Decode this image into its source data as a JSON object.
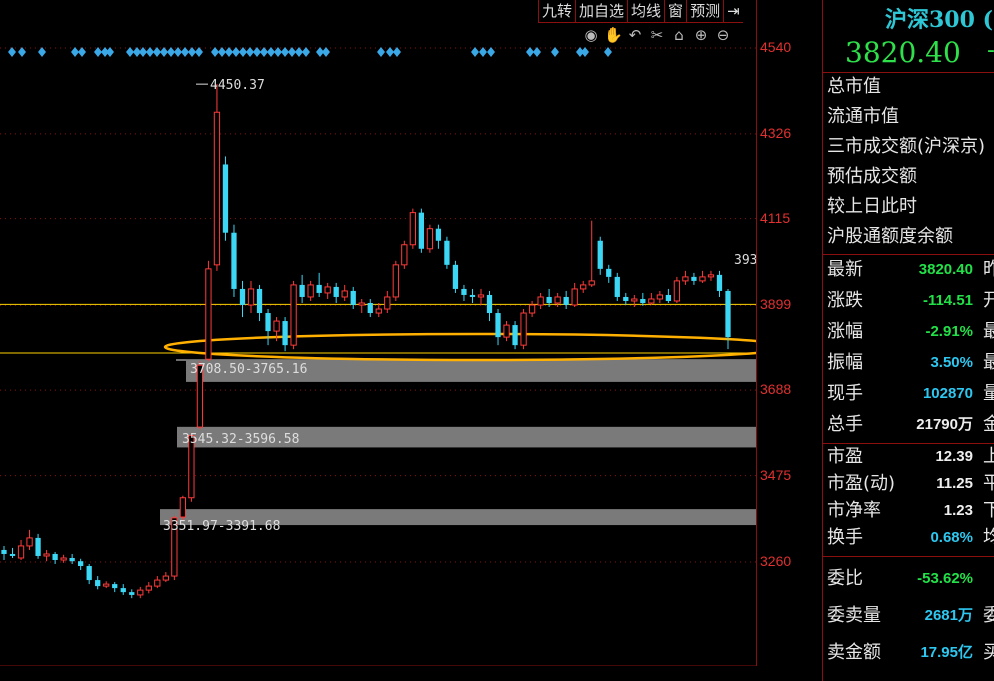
{
  "toolbar": {
    "buttons": [
      {
        "label": "九转",
        "name": "jiuzhuan-button"
      },
      {
        "label": "加自选",
        "name": "add-watchlist-button"
      },
      {
        "label": "均线",
        "name": "moving-average-button"
      },
      {
        "label": "窗",
        "name": "window-button"
      },
      {
        "label": "预测",
        "name": "forecast-button"
      },
      {
        "label": "⇥",
        "name": "expand-panel-button"
      }
    ]
  },
  "tools": [
    {
      "icon": "eye-icon",
      "glyph": "◉"
    },
    {
      "icon": "hand-icon",
      "glyph": "✋"
    },
    {
      "icon": "undo-icon",
      "glyph": "↶"
    },
    {
      "icon": "scissors-icon",
      "glyph": "✂"
    },
    {
      "icon": "lock-icon",
      "glyph": "⌂"
    },
    {
      "icon": "zoom-in-icon",
      "glyph": "⊕"
    },
    {
      "icon": "zoom-out-icon",
      "glyph": "⊖"
    }
  ],
  "axis": {
    "labels": [
      "4540",
      "4326",
      "4115",
      "3899",
      "3688",
      "3475",
      "3260"
    ]
  },
  "annotations": {
    "high_label": "4450.37",
    "gap1": "3708.50-3765.16",
    "gap2": "3545.32-3596.58",
    "gap3": "3351.97-3391.68",
    "cutoff_label": "393"
  },
  "panel": {
    "title": "沪深300 (",
    "price": "3820.40",
    "price_suffix": "-",
    "info_rows": [
      {
        "label": "总市值"
      },
      {
        "label": "流通市值"
      },
      {
        "label": "三市成交额(沪深京)"
      },
      {
        "label": "预估成交额"
      },
      {
        "label": "较上日此时"
      },
      {
        "label": "沪股通额度余额"
      }
    ],
    "quote_rows": [
      {
        "label": "最新",
        "value": "3820.40",
        "color": "green",
        "suffix": "昨"
      },
      {
        "label": "涨跌",
        "value": "-114.51",
        "color": "green",
        "suffix": "开"
      },
      {
        "label": "涨幅",
        "value": "-2.91%",
        "color": "green",
        "suffix": "最"
      },
      {
        "label": "振幅",
        "value": "3.50%",
        "color": "cyan",
        "suffix": "最"
      },
      {
        "label": "现手",
        "value": "102870",
        "color": "cyan",
        "suffix": "量"
      },
      {
        "label": "总手",
        "value": "21790万",
        "color": "white",
        "suffix": "金"
      }
    ],
    "valuation_rows": [
      {
        "label": "市盈",
        "value": "12.39",
        "color": "white",
        "suffix": "上"
      },
      {
        "label": "市盈(动)",
        "value": "11.25",
        "color": "white",
        "suffix": "平"
      },
      {
        "label": "市净率",
        "value": "1.23",
        "color": "white",
        "suffix": "下"
      },
      {
        "label": "换手",
        "value": "0.68%",
        "color": "cyan",
        "suffix": "均"
      }
    ],
    "order_rows": [
      {
        "label": "委比",
        "value": "-53.62%",
        "color": "green",
        "suffix": ""
      },
      {
        "label": "委卖量",
        "value": "2681万",
        "color": "cyan",
        "suffix": "委"
      },
      {
        "label": "卖金额",
        "value": "17.95亿",
        "color": "cyan",
        "suffix": "买"
      }
    ]
  },
  "colors": {
    "up": "#ff3b3b",
    "down": "#3cd7f5",
    "grid": "#8a0f0f",
    "yellow": "#ffd400",
    "gap": "#7a7a7a"
  },
  "chart_data": {
    "type": "candlestick",
    "title": "沪深300",
    "ylim": [
      3150,
      4660
    ],
    "y_ticks": [
      4540,
      4326,
      4115,
      3899,
      3688,
      3475,
      3260
    ],
    "reference_lines": [
      3899,
      3750
    ],
    "gaps": [
      {
        "low": 3708.5,
        "high": 3765.16
      },
      {
        "low": 3545.32,
        "high": 3596.58
      },
      {
        "low": 3351.97,
        "high": 3391.68
      }
    ],
    "last_close": 3820.4,
    "high_point": 4450.37,
    "candles": [
      [
        3290,
        3280,
        3300,
        3265
      ],
      [
        3280,
        3275,
        3295,
        3270
      ],
      [
        3270,
        3300,
        3315,
        3265
      ],
      [
        3300,
        3320,
        3340,
        3290
      ],
      [
        3320,
        3275,
        3330,
        3268
      ],
      [
        3275,
        3280,
        3290,
        3262
      ],
      [
        3280,
        3265,
        3285,
        3255
      ],
      [
        3265,
        3270,
        3278,
        3258
      ],
      [
        3270,
        3262,
        3280,
        3255
      ],
      [
        3262,
        3250,
        3268,
        3240
      ],
      [
        3250,
        3215,
        3255,
        3205
      ],
      [
        3215,
        3200,
        3225,
        3192
      ],
      [
        3200,
        3205,
        3212,
        3195
      ],
      [
        3205,
        3195,
        3210,
        3185
      ],
      [
        3195,
        3185,
        3205,
        3178
      ],
      [
        3185,
        3178,
        3192,
        3170
      ],
      [
        3178,
        3190,
        3198,
        3170
      ],
      [
        3190,
        3200,
        3210,
        3182
      ],
      [
        3200,
        3215,
        3225,
        3195
      ],
      [
        3215,
        3225,
        3235,
        3210
      ],
      [
        3225,
        3370,
        3375,
        3215
      ],
      [
        3372,
        3420,
        3425,
        3365
      ],
      [
        3420,
        3575,
        3580,
        3410
      ],
      [
        3596,
        3750,
        3760,
        3590
      ],
      [
        3765,
        3990,
        4010,
        3760
      ],
      [
        4000,
        4380,
        4450,
        3985
      ],
      [
        4250,
        4080,
        4270,
        4060
      ],
      [
        4080,
        3940,
        4100,
        3920
      ],
      [
        3940,
        3900,
        3960,
        3870
      ],
      [
        3900,
        3940,
        3960,
        3880
      ],
      [
        3940,
        3880,
        3950,
        3860
      ],
      [
        3880,
        3835,
        3890,
        3800
      ],
      [
        3835,
        3860,
        3870,
        3810
      ],
      [
        3860,
        3800,
        3870,
        3785
      ],
      [
        3800,
        3950,
        3960,
        3790
      ],
      [
        3950,
        3920,
        3975,
        3905
      ],
      [
        3920,
        3950,
        3960,
        3910
      ],
      [
        3950,
        3930,
        3980,
        3920
      ],
      [
        3930,
        3945,
        3955,
        3915
      ],
      [
        3945,
        3920,
        3955,
        3905
      ],
      [
        3920,
        3935,
        3950,
        3910
      ],
      [
        3935,
        3900,
        3945,
        3890
      ],
      [
        3900,
        3905,
        3915,
        3880
      ],
      [
        3905,
        3880,
        3915,
        3870
      ],
      [
        3880,
        3890,
        3905,
        3870
      ],
      [
        3890,
        3920,
        3935,
        3880
      ],
      [
        3920,
        4000,
        4010,
        3910
      ],
      [
        4000,
        4050,
        4060,
        3990
      ],
      [
        4050,
        4130,
        4140,
        4040
      ],
      [
        4130,
        4040,
        4140,
        4030
      ],
      [
        4040,
        4090,
        4100,
        4030
      ],
      [
        4090,
        4060,
        4100,
        4040
      ],
      [
        4060,
        4000,
        4070,
        3990
      ],
      [
        4000,
        3940,
        4010,
        3930
      ],
      [
        3940,
        3925,
        3950,
        3910
      ],
      [
        3925,
        3920,
        3940,
        3905
      ],
      [
        3920,
        3925,
        3940,
        3900
      ],
      [
        3925,
        3880,
        3935,
        3860
      ],
      [
        3880,
        3820,
        3890,
        3800
      ],
      [
        3820,
        3850,
        3860,
        3810
      ],
      [
        3850,
        3800,
        3860,
        3790
      ],
      [
        3800,
        3880,
        3890,
        3790
      ],
      [
        3880,
        3900,
        3910,
        3870
      ],
      [
        3900,
        3920,
        3930,
        3890
      ],
      [
        3920,
        3905,
        3940,
        3895
      ],
      [
        3905,
        3920,
        3930,
        3895
      ],
      [
        3920,
        3900,
        3935,
        3890
      ],
      [
        3900,
        3940,
        3955,
        3895
      ],
      [
        3940,
        3950,
        3960,
        3930
      ],
      [
        3950,
        3960,
        4110,
        3945
      ],
      [
        4060,
        3990,
        4070,
        3975
      ],
      [
        3990,
        3970,
        4000,
        3955
      ],
      [
        3970,
        3920,
        3980,
        3910
      ],
      [
        3920,
        3910,
        3930,
        3900
      ],
      [
        3910,
        3915,
        3925,
        3895
      ],
      [
        3915,
        3905,
        3930,
        3898
      ],
      [
        3905,
        3915,
        3930,
        3900
      ],
      [
        3915,
        3925,
        3935,
        3905
      ],
      [
        3925,
        3910,
        3940,
        3905
      ],
      [
        3910,
        3960,
        3970,
        3905
      ],
      [
        3960,
        3970,
        3985,
        3950
      ],
      [
        3970,
        3960,
        3980,
        3950
      ],
      [
        3960,
        3970,
        3985,
        3955
      ],
      [
        3970,
        3975,
        3985,
        3960
      ],
      [
        3975,
        3935,
        3985,
        3920
      ],
      [
        3935,
        3820,
        3940,
        3790
      ]
    ],
    "signals_x": [
      12,
      22,
      42,
      75,
      82,
      98,
      105,
      110,
      130,
      137,
      143,
      150,
      157,
      164,
      171,
      178,
      185,
      192,
      199,
      215,
      222,
      229,
      236,
      243,
      250,
      257,
      264,
      271,
      278,
      285,
      292,
      299,
      306,
      320,
      326,
      381,
      390,
      397,
      475,
      483,
      491,
      530,
      537,
      555,
      580,
      585,
      608
    ]
  }
}
